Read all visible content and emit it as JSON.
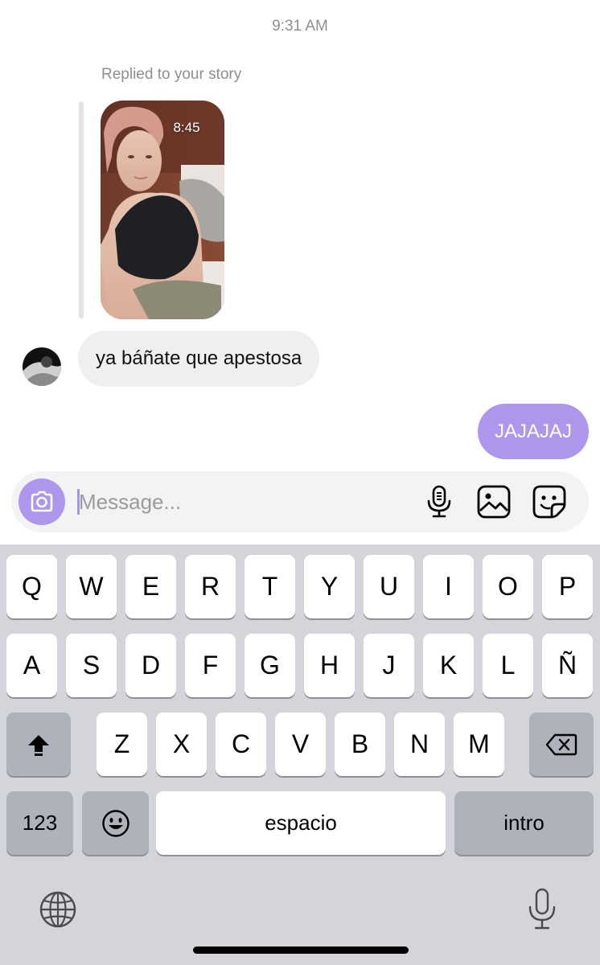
{
  "chat": {
    "timestamp": "9:31 AM",
    "reply_note": "Replied to your story",
    "story": {
      "time_label": "8:45"
    },
    "incoming": {
      "text": "ya báñate que apestosa"
    },
    "outgoing": {
      "text": "JAJAJAJ"
    }
  },
  "composer": {
    "placeholder": "Message...",
    "value": "",
    "camera_icon": "camera-icon",
    "mic_icon": "microphone-icon",
    "gallery_icon": "gallery-icon",
    "sticker_icon": "sticker-icon"
  },
  "keyboard": {
    "row1": [
      "Q",
      "W",
      "E",
      "R",
      "T",
      "Y",
      "U",
      "I",
      "O",
      "P"
    ],
    "row2": [
      "A",
      "S",
      "D",
      "F",
      "G",
      "H",
      "J",
      "K",
      "L",
      "Ñ"
    ],
    "row3": [
      "Z",
      "X",
      "C",
      "V",
      "B",
      "N",
      "M"
    ],
    "numbers_label": "123",
    "space_label": "espacio",
    "return_label": "intro",
    "shift_icon": "shift-icon",
    "delete_icon": "delete-icon",
    "emoji_icon": "emoji-icon",
    "globe_icon": "globe-icon",
    "dictation_icon": "dictation-icon"
  },
  "colors": {
    "accent": "#ad96ec",
    "incoming_bubble": "#efefef",
    "keyboard_bg": "#d3d5db",
    "key_dark": "#aeb2bb"
  }
}
